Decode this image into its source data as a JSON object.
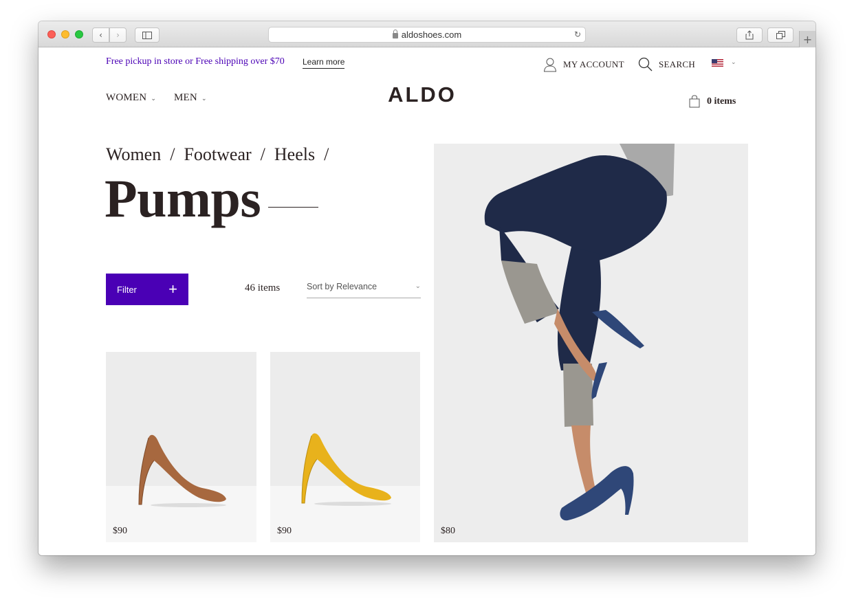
{
  "browser": {
    "url": "aldoshoes.com",
    "back_icon": "chevron-left-icon",
    "forward_icon": "chevron-right-icon"
  },
  "promo": {
    "text": "Free pickup in store or Free shipping over $70",
    "link": "Learn more"
  },
  "utility": {
    "account": "MY ACCOUNT",
    "search": "SEARCH"
  },
  "nav": {
    "women": "WOMEN",
    "men": "MEN"
  },
  "logo": "ALDO",
  "cart": {
    "label": "0 items"
  },
  "breadcrumb": [
    "Women",
    "Footwear",
    "Heels"
  ],
  "page_title": "Pumps",
  "toolbar": {
    "filter": "Filter",
    "item_count": "46 items",
    "sort": "Sort by Relevance"
  },
  "products": [
    {
      "price": "$90",
      "color": "#a7683f"
    },
    {
      "price": "$90",
      "color": "#e8b21c"
    },
    {
      "price": "$80",
      "color": "#2f4778"
    }
  ],
  "colors": {
    "accent": "#4a00b5",
    "text": "#2b2222"
  }
}
